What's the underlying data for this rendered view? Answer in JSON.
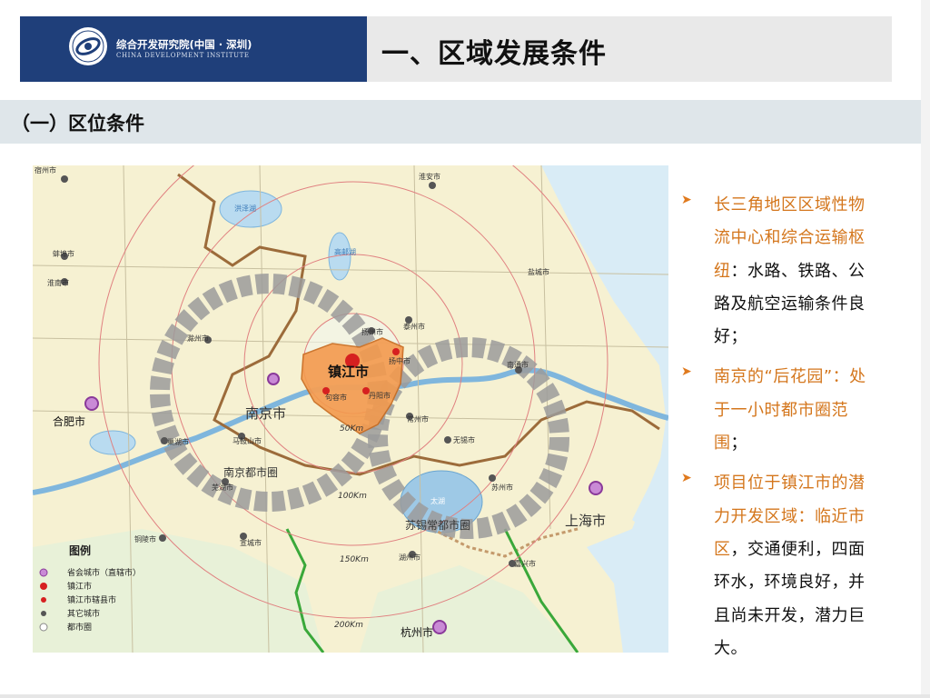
{
  "header": {
    "logo_cn": "综合开发研究院(中国 · 深圳)",
    "logo_en": "CHINA DEVELOPMENT INSTITUTE",
    "title": "一、区域发展条件"
  },
  "section": {
    "title": "（一）区位条件"
  },
  "map": {
    "cities": {
      "suzhou_n": "宿州市",
      "bengbu": "蚌埠市",
      "huainan": "淮南市",
      "chuzhou": "滁州市",
      "hefei": "合肥市",
      "chaohu": "巢湖市",
      "maanshan": "马鞍山市",
      "wuhu": "芜湖市",
      "tongling": "铜陵市",
      "xuancheng": "宣城市",
      "huzhou": "湖州市",
      "hangzhou": "杭州市",
      "jiaxing": "嘉兴市",
      "shanghai": "上海市",
      "suzhou": "苏州市",
      "wuxi": "无锡市",
      "changzhou": "常州市",
      "taizhou": "泰州市",
      "yangzhou": "扬州市",
      "nantong": "南通市",
      "yancheng": "盐城市",
      "huaian": "淮安市",
      "yangzhong": "扬中市",
      "jurong": "句容市",
      "danyang": "丹阳市",
      "nanjing": "南京市",
      "zhenjiang": "镇江市",
      "hongze": "洪泽湖",
      "gaoyou": "高邮湖",
      "taihu": "太湖"
    },
    "metro_rings": {
      "nanjing": "南京都市圈",
      "sxc": "苏锡常都市圈"
    },
    "distances": {
      "d50": "50Km",
      "d100": "100Km",
      "d150": "150Km",
      "d200": "200Km"
    },
    "legend": {
      "title": "图例",
      "items": [
        "省会城市（直辖市）",
        "镇江市",
        "镇江市辖县市",
        "其它城市",
        "都市圈"
      ]
    }
  },
  "bullets": [
    {
      "highlight": "长三角地区区域性物流中心和综合运输枢纽",
      "rest": "：水路、铁路、公路及航空运输条件良好；"
    },
    {
      "highlight": "南京的“后花园”：处于一小时都市圈范围",
      "rest": "；"
    },
    {
      "highlight": "项目位于镇江市的潜力开发区域：临近市区",
      "rest": "，交通便利，四面环水，环境良好，并且尚未开发，潜力巨大。"
    }
  ],
  "colors": {
    "brand_blue": "#1f3f7a",
    "accent_orange": "#d4761c",
    "zhenjiang": "#f39a4e"
  }
}
